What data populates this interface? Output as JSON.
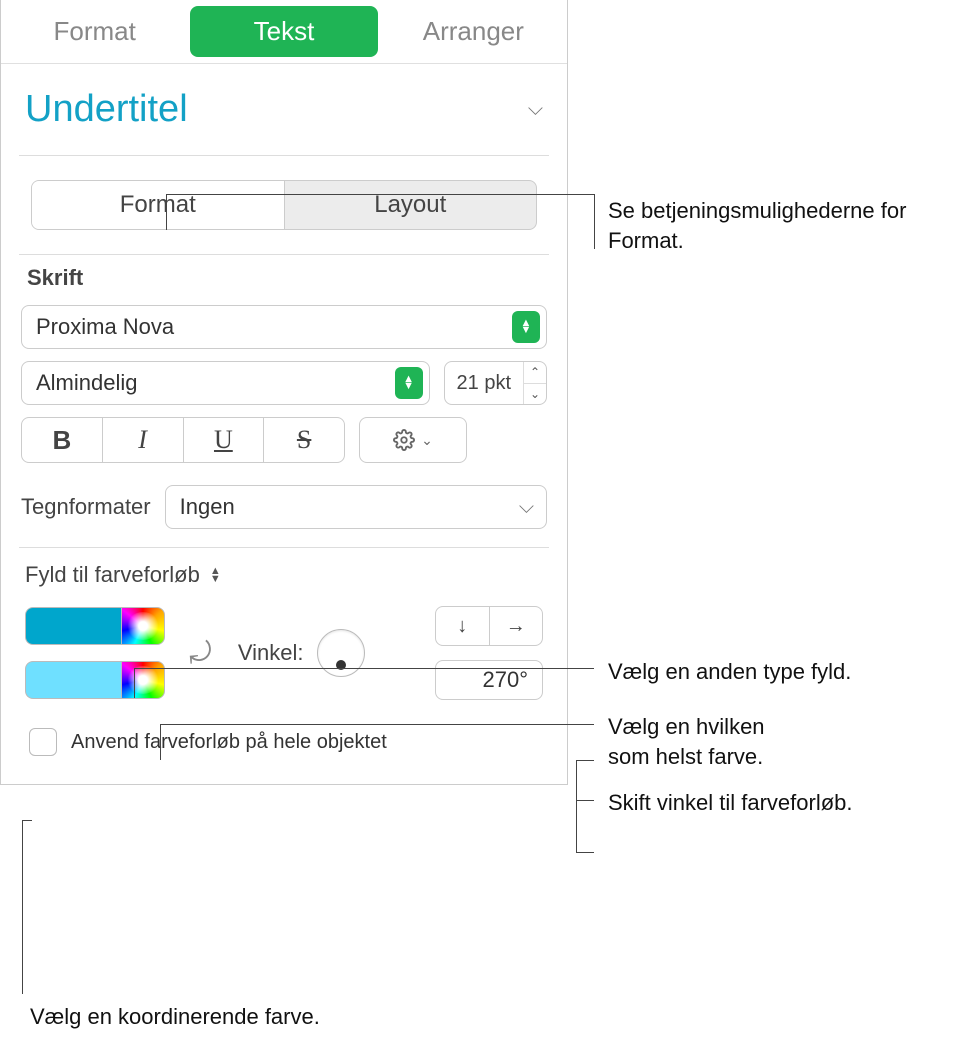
{
  "top_tabs": {
    "format": "Format",
    "tekst": "Tekst",
    "arranger": "Arranger"
  },
  "style": {
    "name": "Undertitel"
  },
  "sub_tabs": {
    "format": "Format",
    "layout": "Layout"
  },
  "font_section": {
    "label": "Skrift",
    "family": "Proxima Nova",
    "weight": "Almindelig",
    "size": "21 pkt",
    "char_formats_label": "Tegnformater",
    "char_formats_value": "Ingen"
  },
  "fill_section": {
    "title": "Fyld til farveforløb",
    "colors": {
      "c1": "#00a6cc",
      "c2": "#6fe0ff"
    },
    "angle_label": "Vinkel:",
    "angle_value": "270°",
    "checkbox_label": "Anvend farveforløb på hele objektet"
  },
  "annotations": {
    "a1": "Se betjeningsmulighederne for Format.",
    "a2": "Vælg en anden type fyld.",
    "a3_l1": "Vælg en hvilken",
    "a3_l2": "som helst farve.",
    "a4": "Skift vinkel til farveforløb.",
    "a5": "Vælg en koordinerende farve."
  }
}
